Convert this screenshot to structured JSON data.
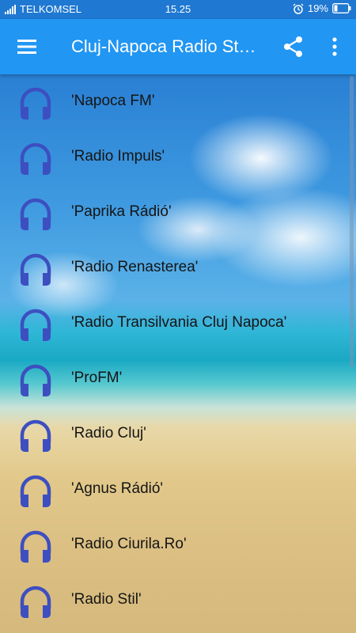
{
  "status_bar": {
    "carrier": "TELKOMSEL",
    "time": "15.25",
    "battery": "19%"
  },
  "app_bar": {
    "title": "Cluj-Napoca Radio Stations",
    "menu_icon": "hamburger-menu-icon",
    "share_icon": "share-icon",
    "more_icon": "more-vertical-icon"
  },
  "stations": [
    {
      "label": "'Napoca FM'",
      "icon": "headphones-icon"
    },
    {
      "label": "'Radio Impuls'",
      "icon": "headphones-icon"
    },
    {
      "label": "'Paprika Rádió'",
      "icon": "headphones-icon"
    },
    {
      "label": "'Radio Renasterea'",
      "icon": "headphones-icon"
    },
    {
      "label": "'Radio Transilvania Cluj Napoca'",
      "icon": "headphones-icon"
    },
    {
      "label": "'ProFM'",
      "icon": "headphones-icon"
    },
    {
      "label": "'Radio Cluj'",
      "icon": "headphones-icon"
    },
    {
      "label": "'Agnus Rádió'",
      "icon": "headphones-icon"
    },
    {
      "label": "'Radio Ciurila.Ro'",
      "icon": "headphones-icon"
    },
    {
      "label": "'Radio Stil'",
      "icon": "headphones-icon"
    }
  ],
  "colors": {
    "app_bar": "#2196f3",
    "status_bar": "#1f78d1",
    "icon": "#3d4fc0"
  }
}
